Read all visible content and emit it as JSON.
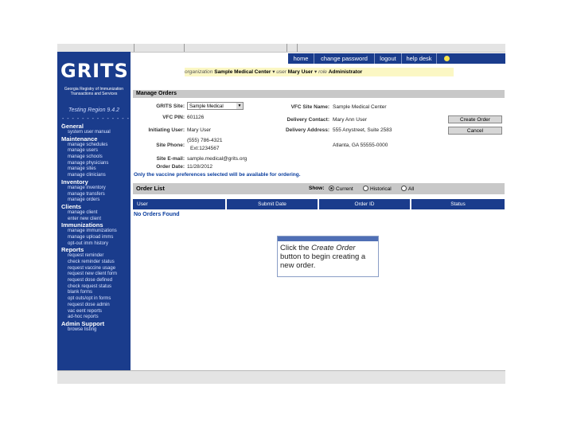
{
  "logo": {
    "text": "GRITS",
    "subtitle": "Georgia Registry of Immunization Transactions and Services"
  },
  "sidebar": {
    "region": "Testing Region 9.4.2",
    "dashes": "- - - - - - - - - - - - - - -",
    "sections": [
      {
        "heading": "General",
        "items": [
          "system user manual"
        ]
      },
      {
        "heading": "Maintenance",
        "items": [
          "manage schedules",
          "manage users",
          "manage schools",
          "manage physicians",
          "manage sites",
          "manage clinicians"
        ]
      },
      {
        "heading": "Inventory",
        "items": [
          "manage inventory",
          "manage transfers",
          "manage orders"
        ]
      },
      {
        "heading": "Clients",
        "items": [
          "manage client",
          "enter new client"
        ]
      },
      {
        "heading": "Immunizations",
        "items": [
          "manage immunizations",
          "manage upload imms",
          "opt-out imm history"
        ]
      },
      {
        "heading": "Reports",
        "items": [
          "request reminder",
          "check reminder status",
          "request vaccine usage",
          "request new client form",
          "request dose defined",
          "check request status",
          "blank forms",
          "opt outs/opt in forms",
          "request dose admin",
          "vac eent reports",
          "ad-hoc reports"
        ]
      },
      {
        "heading": "Admin Support",
        "items": [
          "browse listing"
        ]
      }
    ]
  },
  "navbar": {
    "links": [
      "home",
      "change password",
      "logout",
      "help desk"
    ]
  },
  "orgbar": {
    "org_label": "organization",
    "org_value": "Sample Medical Center",
    "user_label": "user",
    "user_value": "Mary User",
    "role_label": "role",
    "role_value": "Administrator"
  },
  "manage_orders": {
    "header": "Manage Orders",
    "grits_site_label": "GRITS Site:",
    "grits_site_value": "Sample Medical",
    "vfc_pin_label": "VFC PIN:",
    "vfc_pin_value": "601126",
    "initiating_user_label": "Initiating User:",
    "initiating_user_value": "Mary User",
    "site_phone_label": "Site Phone:",
    "site_phone_value": "(555) 786-4321",
    "site_phone_ext": "Ext:1234567",
    "site_email_label": "Site E-mail:",
    "site_email_value": "sample.medical@grits.org",
    "order_date_label": "Order Date:",
    "order_date_value": "11/28/2012",
    "vfc_site_name_label": "VFC Site Name:",
    "vfc_site_name_value": "Sample Medical Center",
    "delivery_contact_label": "Delivery Contact:",
    "delivery_contact_value": "Mary Ann User",
    "delivery_address_label": "Delivery Address:",
    "delivery_address_value": "555 Anystreet, Suite 2583",
    "delivery_city": "Atlanta, GA 55555-0000",
    "create_button": "Create Order",
    "cancel_button": "Cancel",
    "note": "Only the vaccine preferences selected will be available for ordering."
  },
  "order_list": {
    "title": "Order List",
    "show_label": "Show:",
    "options": [
      {
        "label": "Current",
        "selected": true
      },
      {
        "label": "Historical",
        "selected": false
      },
      {
        "label": "All",
        "selected": false
      }
    ],
    "columns": [
      "User",
      "Submit Date",
      "Order ID",
      "Status"
    ],
    "empty_message": "No Orders Found"
  },
  "callout": {
    "text_before": "Click the ",
    "emphasis": "Create Order",
    "text_after": " button to begin creating a new order."
  },
  "colors": {
    "sidebar": "#1a3c8c",
    "accent_note": "#0b3e9e",
    "org_bar": "#fbf7c4",
    "section_header": "#c8c8c8"
  }
}
